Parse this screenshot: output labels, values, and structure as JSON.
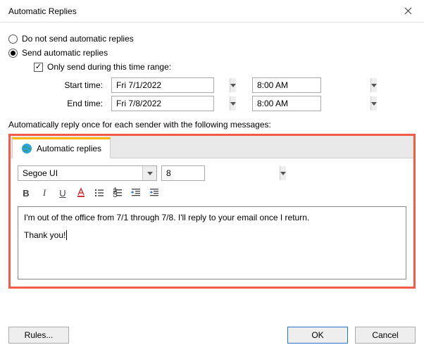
{
  "window": {
    "title": "Automatic Replies"
  },
  "radios": {
    "dont_send": "Do not send automatic replies",
    "send": "Send automatic replies"
  },
  "checkbox": {
    "only_range": "Only send during this time range:"
  },
  "time": {
    "start_label": "Start time:",
    "end_label": "End time:",
    "start_date": "Fri 7/1/2022",
    "end_date": "Fri 7/8/2022",
    "start_time": "8:00 AM",
    "end_time": "8:00 AM"
  },
  "instruction": "Automatically reply once for each sender with the following messages:",
  "tab": {
    "label": "Automatic replies"
  },
  "format": {
    "font": "Segoe UI",
    "size": "8"
  },
  "message": {
    "line1": "I'm out of the office from 7/1 through 7/8. I'll reply to your email once I return.",
    "line2": "Thank you!"
  },
  "buttons": {
    "rules": "Rules...",
    "ok": "OK",
    "cancel": "Cancel"
  }
}
